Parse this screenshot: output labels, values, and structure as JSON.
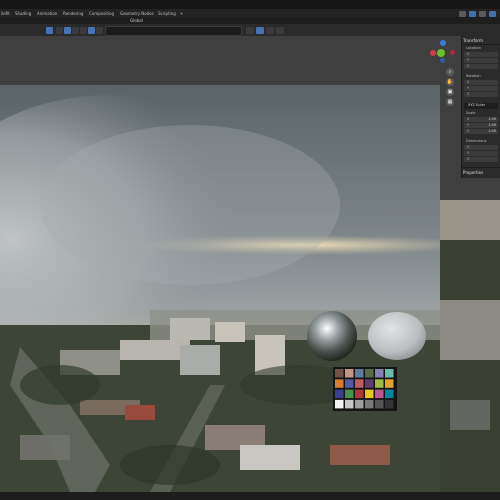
{
  "menu": {
    "workspaces": [
      "ilefit",
      "Shading",
      "Animation",
      "Rendering",
      "Compositing",
      "Geometry Nodes",
      "Scripting",
      "+"
    ]
  },
  "header": {
    "orientation": "Global",
    "search_placeholder": ""
  },
  "npanel": {
    "transform_title": "Transform",
    "location_label": "Location",
    "location": [
      {
        "axis": "X",
        "value": ""
      },
      {
        "axis": "Y",
        "value": ""
      },
      {
        "axis": "Z",
        "value": ""
      }
    ],
    "rotation_label": "Rotation",
    "rotation": [
      {
        "axis": "X",
        "value": ""
      },
      {
        "axis": "Y",
        "value": ""
      },
      {
        "axis": "Z",
        "value": ""
      }
    ],
    "rotation_mode": "XYZ Euler",
    "scale_label": "Scale",
    "scale": [
      {
        "axis": "X",
        "value": "1.00"
      },
      {
        "axis": "Y",
        "value": "1.00"
      },
      {
        "axis": "Z",
        "value": "1.00"
      }
    ],
    "dimensions_label": "Dimensions",
    "dimensions": [
      {
        "axis": "X",
        "value": ""
      },
      {
        "axis": "Y",
        "value": ""
      },
      {
        "axis": "Z",
        "value": ""
      }
    ],
    "properties_title": "Properties"
  },
  "colors": {
    "accent": "#4772b3",
    "gizmo_x": "#d23b4a",
    "gizmo_y": "#6bbf27",
    "gizmo_z": "#3d7be0"
  },
  "checker_colors": [
    "#735244",
    "#c29682",
    "#627a9d",
    "#576c43",
    "#8580b1",
    "#67bdaa",
    "#d67e2c",
    "#505ba6",
    "#c15a63",
    "#5e3c6c",
    "#9dbc40",
    "#e0a32e",
    "#383d96",
    "#469449",
    "#af363c",
    "#e7c71f",
    "#bb5695",
    "#0885a1",
    "#f3f3f2",
    "#c8c8c8",
    "#a0a0a0",
    "#7a7a79",
    "#555555",
    "#343434"
  ]
}
